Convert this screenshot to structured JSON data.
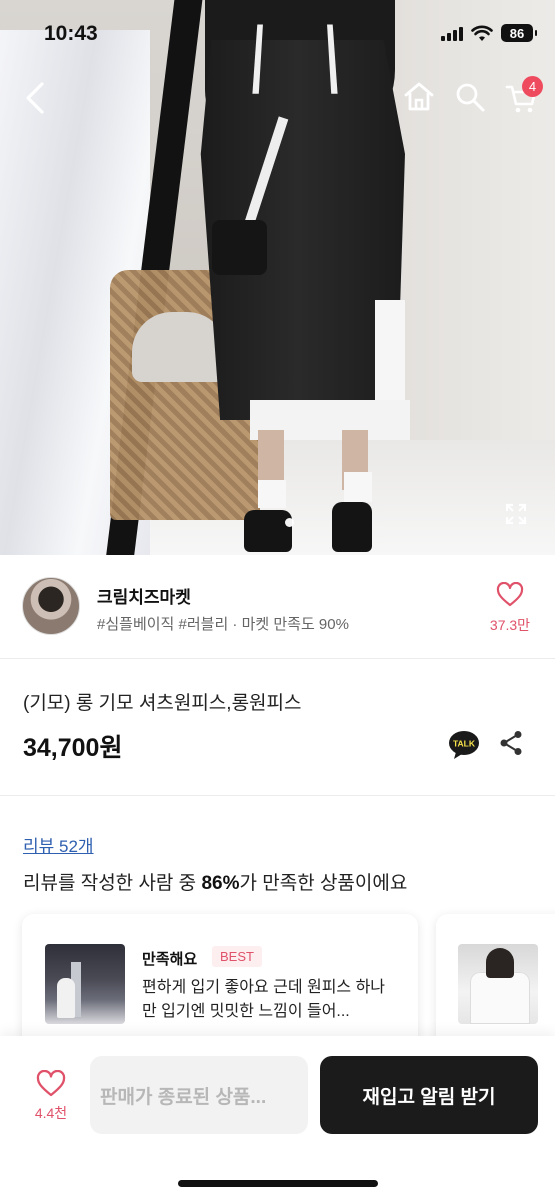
{
  "status_bar": {
    "time": "10:43",
    "battery": "86"
  },
  "nav": {
    "cart_count": "4",
    "icons": [
      "back-icon",
      "home-icon",
      "search-icon",
      "cart-icon"
    ]
  },
  "gallery": {
    "current_index": 1,
    "total": 1
  },
  "seller": {
    "name": "크림치즈마켓",
    "tags": "#심플베이직 #러블리 · 마켓 만족도 90%",
    "like_count": "37.3만"
  },
  "product": {
    "title": "(기모) 롱 기모 셔츠원피스,롱원피스",
    "price": "34,700원"
  },
  "reviews": {
    "link_label": "리뷰 52개",
    "summary_prefix": "리뷰를 작성한 사람 중 ",
    "summary_percent": "86%",
    "summary_suffix": "가 만족한 상품이에요",
    "items": [
      {
        "rating_label": "만족해요",
        "badge": "BEST",
        "text": "편하게 입기 좋아요 근데 원피스 하나만 입기엔 밋밋한 느낌이 들어..."
      }
    ]
  },
  "bottom_bar": {
    "like_count": "4.4천",
    "sold_out_label": "판매가 종료된 상품...",
    "restock_label": "재입고 알림 받기"
  },
  "colors": {
    "accent": "#e0526a",
    "badge": "#ef4b5f",
    "cta": "#1b1b1b",
    "link": "#2f5fb0"
  }
}
